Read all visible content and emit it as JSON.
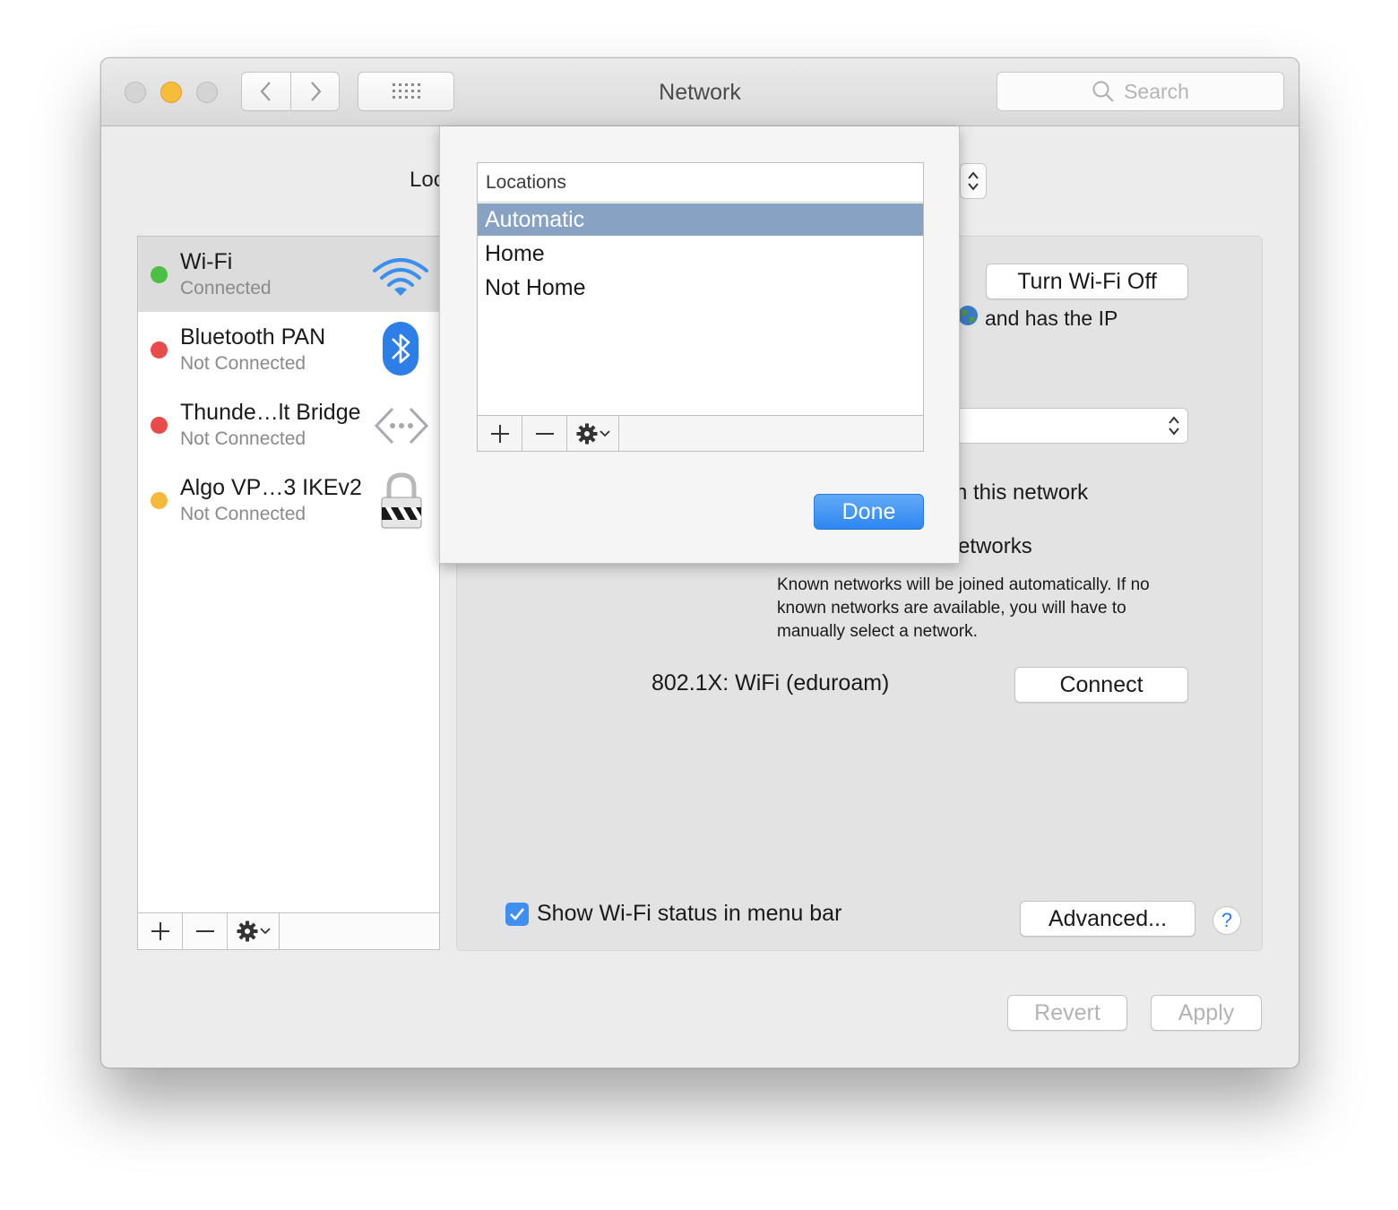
{
  "window": {
    "title": "Network",
    "search_placeholder": "Search"
  },
  "location": {
    "label": "Loc"
  },
  "services": [
    {
      "name": "Wi-Fi",
      "status": "Connected",
      "status_color": "#4cbf45",
      "icon": "wifi-icon"
    },
    {
      "name": "Bluetooth PAN",
      "status": "Not Connected",
      "status_color": "#e94b4b",
      "icon": "bluetooth-icon"
    },
    {
      "name": "Thunde…lt Bridge",
      "status": "Not Connected",
      "status_color": "#e94b4b",
      "icon": "bridge-icon"
    },
    {
      "name": "Algo VP…3 IKEv2",
      "status": "Not Connected",
      "status_color": "#f4b83b",
      "icon": "vpn-lock-icon"
    }
  ],
  "sidebar_toolbar": {
    "add": "+",
    "remove": "—"
  },
  "wifi_panel": {
    "turn_off_label": "Turn Wi-Fi Off",
    "status_fragment": "and has the IP",
    "ask_fragment": "n this network",
    "networks_fragment": "etworks",
    "known_networks_text": "Known networks will be joined automatically. If no known networks are available, you will have to manually select a network.",
    "dot1x_label": "802.1X:  WiFi (eduroam)",
    "connect_label": "Connect",
    "show_status_label": "Show Wi-Fi status in menu bar",
    "show_status_checked": true,
    "advanced_label": "Advanced...",
    "help_label": "?"
  },
  "footer": {
    "revert_label": "Revert",
    "apply_label": "Apply"
  },
  "locations_sheet": {
    "header": "Locations",
    "items": [
      {
        "label": "Automatic",
        "selected": true
      },
      {
        "label": "Home",
        "selected": false
      },
      {
        "label": "Not Home",
        "selected": false
      }
    ],
    "add": "+",
    "remove": "—",
    "done_label": "Done"
  },
  "colors": {
    "accent": "#2e86f1",
    "selection": "#88a2c4"
  }
}
